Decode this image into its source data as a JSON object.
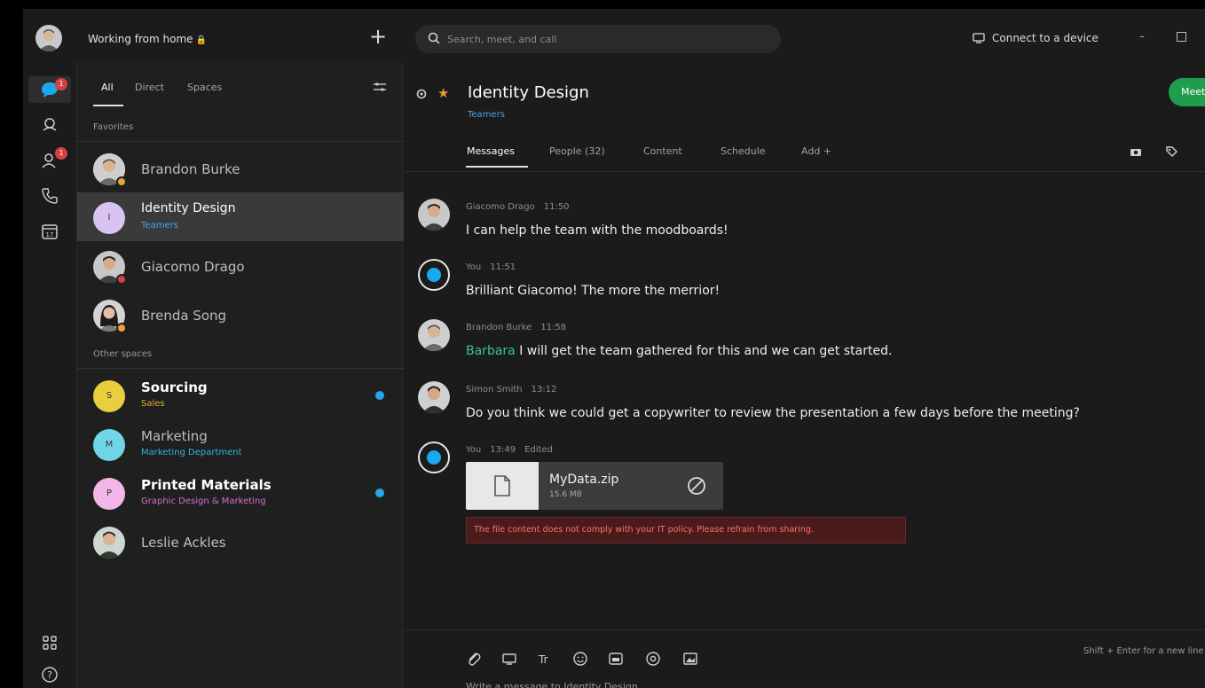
{
  "titlebar": {
    "status": "Working from home",
    "search_placeholder": "Search, meet, and call",
    "connect_label": "Connect to a device"
  },
  "rail": {
    "messaging_badge": "1",
    "contacts_badge": "1"
  },
  "filters": {
    "all": "All",
    "direct": "Direct",
    "spaces": "Spaces"
  },
  "sections": {
    "favorites": "Favorites",
    "other": "Other spaces"
  },
  "conversations": [
    {
      "name": "Brandon Burke"
    },
    {
      "name": "Identity Design",
      "sub": "Teamers",
      "letter": "I"
    },
    {
      "name": "Giacomo Drago"
    },
    {
      "name": "Brenda Song"
    },
    {
      "name": "Sourcing",
      "sub": "Sales",
      "letter": "S"
    },
    {
      "name": "Marketing",
      "sub": "Marketing Department",
      "letter": "M"
    },
    {
      "name": "Printed Materials",
      "sub": "Graphic Design & Marketing",
      "letter": "P"
    },
    {
      "name": "Leslie Ackles"
    }
  ],
  "space": {
    "title": "Identity Design",
    "subtitle": "Teamers",
    "meet_label": "Meet"
  },
  "tabs": {
    "messages": "Messages",
    "people": "People (32)",
    "content": "Content",
    "schedule": "Schedule",
    "add": "Add +"
  },
  "messages": [
    {
      "author": "Giacomo Drago",
      "time": "11:50",
      "text": "I can help the team with the moodboards!"
    },
    {
      "author": "You",
      "time": "11:51",
      "text": "Brilliant Giacomo! The more the merrior!"
    },
    {
      "author": "Brandon Burke",
      "time": "11:58",
      "mention": "Barbara",
      "text": " I will get the team gathered for this and we can get started."
    },
    {
      "author": "Simon Smith",
      "time": "13:12",
      "text": "Do you think we could get a copywriter to review the presentation a few days before the meeting?"
    },
    {
      "author": "You",
      "time": "13:49",
      "edited": "Edited"
    }
  ],
  "file": {
    "name": "MyData.zip",
    "size": "15.6 MB",
    "warning": "The file content does not comply with your IT policy. Please refrain from sharing."
  },
  "composer": {
    "hint": "Shift + Enter for a new line",
    "placeholder": "Write a message to Identity Design"
  },
  "colors": {
    "accent_blue": "#18a9f0",
    "meet_green": "#1f9d4c",
    "mention_teal": "#35c4a0",
    "warning_red": "#ff6e6e"
  }
}
